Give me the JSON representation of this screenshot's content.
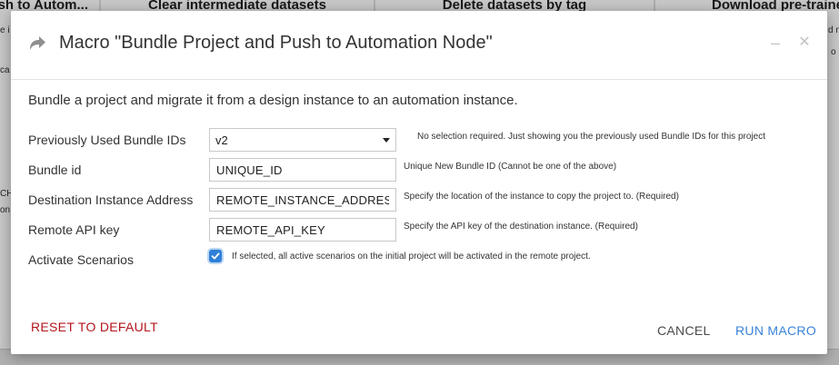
{
  "background": {
    "cards": [
      {
        "title": "sh to Autom..."
      },
      {
        "title": "Clear  intermediate  datasets"
      },
      {
        "title": "Delete datasets by tag"
      },
      {
        "title": "Download pre-traine"
      }
    ],
    "side_fragments": [
      "e i",
      "ca",
      "CH",
      "on"
    ],
    "right_fragments": [
      "d n",
      "o"
    ]
  },
  "modal": {
    "title": "Macro \"Bundle Project and Push to Automation Node\"",
    "header_icon": "share-arrow-icon",
    "minimize_icon": "minimize-icon",
    "close_icon": "close-icon",
    "description": "Bundle a project and migrate it from a design instance to an automation instance.",
    "params": {
      "previous_bundles": {
        "label": "Previously Used Bundle IDs",
        "selected": "v2",
        "help": "No selection required. Just showing you the previously used Bundle IDs for this project"
      },
      "bundle_id": {
        "label": "Bundle id",
        "value": "UNIQUE_ID",
        "help": "Unique New Bundle ID (Cannot be one of the above)"
      },
      "destination": {
        "label": "Destination Instance Address",
        "value": "REMOTE_INSTANCE_ADDRESS",
        "help": "Specify the location of the instance to copy the project to. (Required)"
      },
      "api_key": {
        "label": "Remote API key",
        "value": "REMOTE_API_KEY",
        "help": "Specify the API key of the destination instance. (Required)"
      },
      "activate": {
        "label": "Activate Scenarios",
        "checked": true,
        "help": "If selected, all active scenarios on the initial project will be activated in the remote project."
      }
    },
    "footer": {
      "reset": "Reset to default",
      "cancel": "Cancel",
      "run": "Run macro"
    }
  },
  "colors": {
    "accent": "#3a83d9",
    "danger": "#b3151b",
    "checkbox": "#2f80d8"
  }
}
